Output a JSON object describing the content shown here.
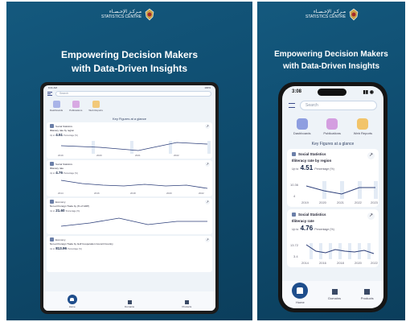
{
  "brand": {
    "arabic": "مـركـز الإحـصـاء",
    "english": "STATISTICS CENTRE"
  },
  "headline": {
    "line1": "Empowering Decision Makers",
    "line2": "with Data-Driven Insights"
  },
  "search": {
    "placeholder": "Search"
  },
  "quick_links": [
    "Dashboards",
    "Publications",
    "Web Reports"
  ],
  "key_figures_title": "Key Figures at a glance",
  "cards": [
    {
      "section": "Social Statistics",
      "subtitle": "Illiteracy rate by region",
      "prefix": "Up to",
      "value": "4.51",
      "unit": "Percentage (%)",
      "years": [
        "2019",
        "2020",
        "2021",
        "2022",
        "2023"
      ]
    },
    {
      "section": "Social Statistics",
      "subtitle": "Illiteracy rate",
      "prefix": "Up to",
      "value": "4.76",
      "unit": "Percentage (%)",
      "years": [
        "2014",
        "2016",
        "2018",
        "2020",
        "2022"
      ]
    },
    {
      "section": "Economy",
      "subtitle": "Non-oil Foreign Trade by (% of GDP)",
      "prefix": "Up to",
      "value": "21.60",
      "unit": "Percentage (%)"
    },
    {
      "section": "Economy",
      "subtitle": "Non-oil Foreign Trade by Gulf Cooperation Council Country",
      "prefix": "Up to",
      "value": "813.96",
      "unit": "Percentage (%)"
    }
  ],
  "nav": [
    "Home",
    "Domains",
    "Products"
  ],
  "tablet_status": {
    "time": "9:41 AM",
    "battery": "100%"
  },
  "phone_status": {
    "time": "3:08"
  },
  "phone_axis": {
    "y1": [
      "10.36",
      "4"
    ],
    "y2": [
      "13.72",
      "3.4"
    ]
  }
}
